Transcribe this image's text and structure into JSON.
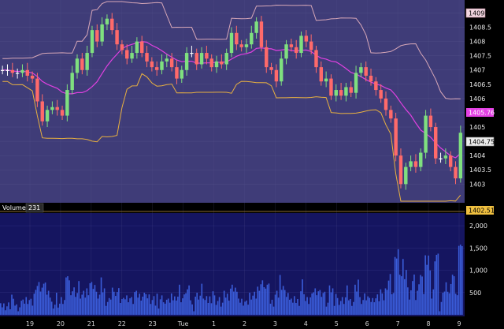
{
  "colors": {
    "price_bg": "#3f3c78",
    "volume_bg": "#151560",
    "axis_bg": "#000000",
    "grid": "#5a5890",
    "bar_up": "#7fe07f",
    "bar_down": "#ff6a6a",
    "bar_flat": "#ffffff",
    "band_upper": "#d8a8b8",
    "band_mid": "#e040e0",
    "band_lower": "#e8b040",
    "volume_bar": "#3a5cd8",
    "panel_border": "#8a6a30"
  },
  "chart_data": [
    {
      "type": "bar",
      "subtype": "ohlc-price-with-bands",
      "y_ticks": [
        "1409",
        "1408.5",
        "1408",
        "1407.5",
        "1407",
        "1406.5",
        "1406",
        "1405.5",
        "1405",
        "1404.5",
        "1404",
        "1403.5",
        "1403"
      ],
      "ylim": [
        1402.4,
        1409.4
      ],
      "x_ticks": [
        "19",
        "20",
        "21",
        "22",
        "23",
        "Tue",
        "1",
        "2",
        "3",
        "4",
        "5",
        "6",
        "7",
        "8",
        "9"
      ],
      "close": [
        1407.0,
        1407.0,
        1406.9,
        1406.9,
        1407.0,
        1406.8,
        1406.7,
        1405.9,
        1405.2,
        1405.6,
        1405.7,
        1405.6,
        1405.4,
        1406.3,
        1406.9,
        1407.4,
        1407.0,
        1407.6,
        1408.4,
        1408.0,
        1408.6,
        1408.8,
        1408.4,
        1407.9,
        1407.7,
        1407.4,
        1407.6,
        1408.0,
        1407.6,
        1407.3,
        1407.1,
        1407.0,
        1407.3,
        1407.4,
        1407.1,
        1406.7,
        1407.0,
        1407.6,
        1407.6,
        1407.2,
        1407.6,
        1407.4,
        1407.1,
        1407.3,
        1407.2,
        1407.6,
        1408.3,
        1407.9,
        1407.8,
        1407.9,
        1408.3,
        1408.7,
        1407.8,
        1407.1,
        1407.0,
        1406.6,
        1407.4,
        1407.9,
        1407.8,
        1407.6,
        1408.2,
        1408.0,
        1407.7,
        1407.1,
        1406.6,
        1406.7,
        1406.1,
        1406.3,
        1406.1,
        1406.4,
        1406.2,
        1406.9,
        1407.1,
        1406.8,
        1406.6,
        1406.3,
        1406.0,
        1405.6,
        1405.3,
        1404.0,
        1403.0,
        1403.6,
        1403.8,
        1403.6,
        1404.1,
        1405.4,
        1405.0,
        1403.9,
        1403.9,
        1404.0,
        1403.6,
        1403.2,
        1404.8
      ],
      "bands": {
        "upper_last": "1409",
        "mid_last": "1405.76",
        "lower_last": "1402.51",
        "last_price": "1404.75"
      }
    },
    {
      "type": "bar",
      "subtype": "volume",
      "panel_label": "Volume",
      "last_volume": "231",
      "y_ticks": [
        "2,000",
        "1,500",
        "1,000",
        "500"
      ],
      "ylim": [
        0,
        2250
      ]
    }
  ]
}
